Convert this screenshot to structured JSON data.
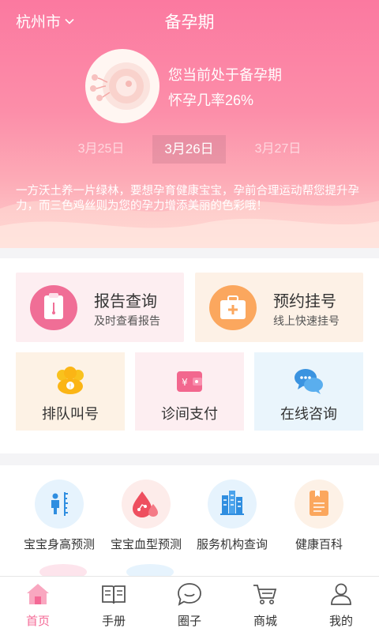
{
  "header": {
    "city": "杭州市",
    "title": "备孕期"
  },
  "status": {
    "line1": "您当前处于备孕期",
    "line2": "怀孕几率26%"
  },
  "dates": {
    "prev": "3月25日",
    "current": "3月26日",
    "next": "3月27日"
  },
  "tip": "一方沃土养一片绿林，要想孕育健康宝宝，孕前合理运动帮您提升孕力，而三色鸡丝则为您的孕力增添美丽的色彩哦！",
  "main_cards": [
    {
      "title": "报告查询",
      "subtitle": "及时查看报告"
    },
    {
      "title": "预约挂号",
      "subtitle": "线上快速挂号"
    }
  ],
  "small_cards": [
    {
      "label": "排队叫号"
    },
    {
      "label": "诊间支付"
    },
    {
      "label": "在线咨询"
    }
  ],
  "services": [
    {
      "label": "宝宝身高预测"
    },
    {
      "label": "宝宝血型预测"
    },
    {
      "label": "服务机构查询"
    },
    {
      "label": "健康百科"
    }
  ],
  "tabs": [
    {
      "label": "首页",
      "icon": "home-icon",
      "active": true
    },
    {
      "label": "手册",
      "icon": "book-icon",
      "active": false
    },
    {
      "label": "圈子",
      "icon": "chat-bubble-icon",
      "active": false
    },
    {
      "label": "商城",
      "icon": "cart-icon",
      "active": false
    },
    {
      "label": "我的",
      "icon": "user-icon",
      "active": false
    }
  ],
  "colors": {
    "brand_pink": "#f46996",
    "report_card_bg": "#fdeef1",
    "appoint_card_bg": "#fdf1e6",
    "consult_card_bg": "#eaf5fc"
  }
}
